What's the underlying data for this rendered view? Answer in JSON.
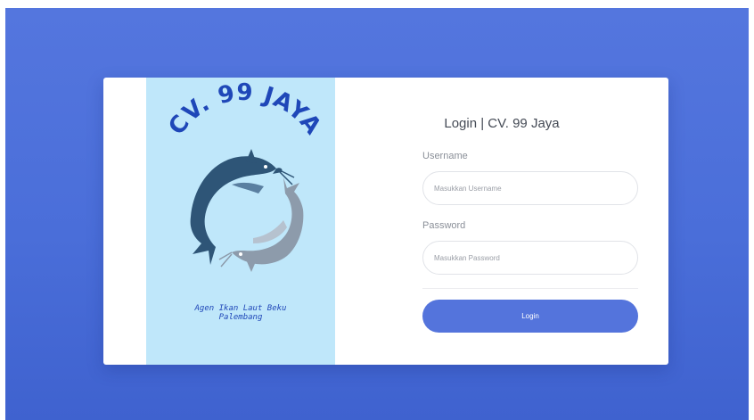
{
  "brand": {
    "logo_text": "CV. 99 JAYA",
    "tagline_line1": "Agen Ikan Laut Beku",
    "tagline_line2": "Palembang"
  },
  "login": {
    "title": "Login | CV. 99 Jaya",
    "username_label": "Username",
    "username_placeholder": "Masukkan Username",
    "password_label": "Password",
    "password_placeholder": "Masukkan Password",
    "submit_label": "Login"
  },
  "colors": {
    "page_background": "#4a6ed9",
    "brand_panel": "#bfe7fa",
    "accent": "#5474dc",
    "logo_text": "#1f47b8",
    "fish_dark": "#2e5577",
    "fish_light": "#8d9bab"
  }
}
